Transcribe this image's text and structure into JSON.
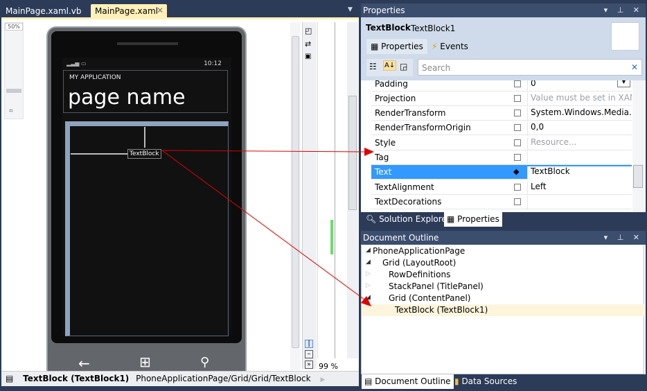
{
  "doc_tabs": [
    {
      "label": "MainPage.xaml.vb",
      "active": false
    },
    {
      "label": "MainPage.xaml",
      "active": true
    }
  ],
  "designer": {
    "zoom_label": "50%",
    "phone": {
      "status_time": "10:12",
      "app_title": "MY APPLICATION",
      "page_title": "page name",
      "textblock": "TextBlock"
    },
    "split_zoom": "99 %",
    "status": {
      "element": "TextBlock (TextBlock1)",
      "path": "PhoneApplicationPage/Grid/Grid/TextBlock"
    }
  },
  "properties": {
    "title": "Properties",
    "type": "TextBlock",
    "name": "TextBlock1",
    "tabs": [
      {
        "label": "Properties",
        "active": true
      },
      {
        "label": "Events",
        "active": false
      }
    ],
    "search_placeholder": "Search",
    "rows": [
      {
        "name": "Padding",
        "value": "0"
      },
      {
        "name": "Projection",
        "value": "Value must be set in XAML"
      },
      {
        "name": "RenderTransform",
        "value": "System.Windows.Media.Ma"
      },
      {
        "name": "RenderTransformOrigin",
        "value": "0,0"
      },
      {
        "name": "Style",
        "value": "Resource..."
      },
      {
        "name": "Tag",
        "value": ""
      },
      {
        "name": "Text",
        "value": "TextBlock",
        "selected": true
      },
      {
        "name": "TextAlignment",
        "value": "Left"
      },
      {
        "name": "TextDecorations",
        "value": ""
      }
    ],
    "bottom_tabs": [
      {
        "label": "Solution Explorer",
        "active": false
      },
      {
        "label": "Properties",
        "active": true
      }
    ]
  },
  "outline": {
    "title": "Document Outline",
    "items": [
      {
        "label": "PhoneApplicationPage",
        "expander": "expanded"
      },
      {
        "label": "Grid (LayoutRoot)",
        "expander": "expanded"
      },
      {
        "label": "RowDefinitions",
        "expander": "collapsed"
      },
      {
        "label": "StackPanel (TitlePanel)",
        "expander": "collapsed"
      },
      {
        "label": "Grid (ContentPanel)",
        "expander": "expanded"
      },
      {
        "label": "TextBlock (TextBlock1)",
        "selected": true
      }
    ],
    "bottom_tabs": [
      {
        "label": "Document Outline",
        "active": true
      },
      {
        "label": "Data Sources",
        "active": false
      }
    ]
  },
  "colors": {
    "selection": "#3399ff",
    "annotation_arrow": "#e00000",
    "highlight_row": "#fdf4dc"
  }
}
